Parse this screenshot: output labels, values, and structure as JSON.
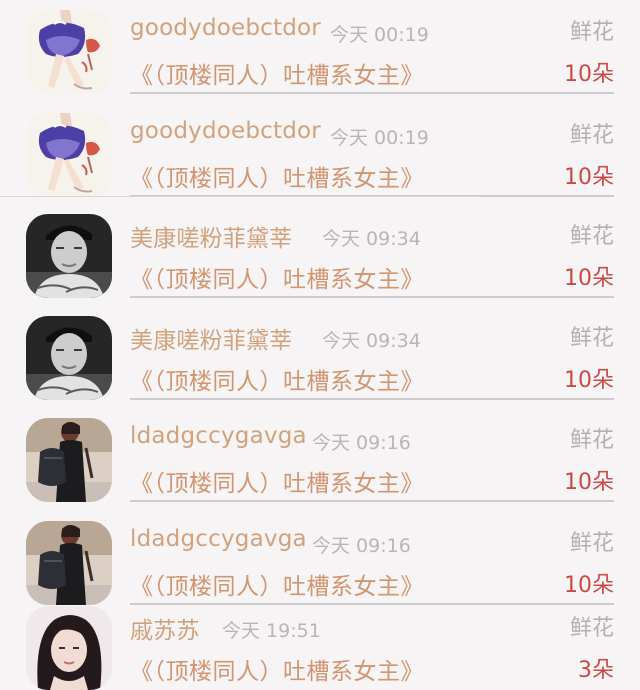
{
  "gifts": [
    {
      "user": "goodydoebctdor",
      "time": "今天 00:19",
      "gift_type": "鲜花",
      "book": "《（顶楼同人）吐槽系女主》",
      "amount": "10朵",
      "avatar_icon": "dancer-illustration-avatar"
    },
    {
      "user": "goodydoebctdor",
      "time": "今天 00:19",
      "gift_type": "鲜花",
      "book": "《（顶楼同人）吐槽系女主》",
      "amount": "10朵",
      "avatar_icon": "dancer-illustration-avatar"
    },
    {
      "user": "美康嗟粉菲黛莘",
      "time": "今天 09:34",
      "gift_type": "鲜花",
      "book": "《（顶楼同人）吐槽系女主》",
      "amount": "10朵",
      "avatar_icon": "man-bw-photo-avatar"
    },
    {
      "user": "美康嗟粉菲黛莘",
      "time": "今天 09:34",
      "gift_type": "鲜花",
      "book": "《（顶楼同人）吐槽系女主》",
      "amount": "10朵",
      "avatar_icon": "man-bw-photo-avatar"
    },
    {
      "user": "ldadgccygavga",
      "time": "今天 09:16",
      "gift_type": "鲜花",
      "book": "《（顶楼同人）吐槽系女主》",
      "amount": "10朵",
      "avatar_icon": "backpack-person-avatar"
    },
    {
      "user": "ldadgccygavga",
      "time": "今天 09:16",
      "gift_type": "鲜花",
      "book": "《（顶楼同人）吐槽系女主》",
      "amount": "10朵",
      "avatar_icon": "backpack-person-avatar"
    },
    {
      "user": "戚苏苏",
      "time": "今天 19:51",
      "gift_type": "鲜花",
      "book": "《（顶楼同人）吐槽系女主》",
      "amount": "3朵",
      "avatar_icon": "woman-portrait-avatar"
    }
  ],
  "colors": {
    "username": "#d2a27c",
    "book_title": "#d29570",
    "amount": "#cc4a44",
    "muted": "#b4b0b2",
    "background": "#f7f4f6"
  }
}
